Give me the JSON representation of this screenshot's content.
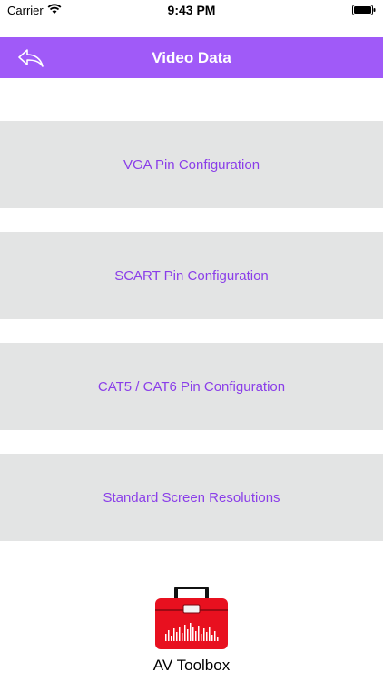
{
  "status_bar": {
    "carrier": "Carrier",
    "time": "9:43 PM",
    "wifi_icon": "wifi-icon",
    "battery_icon": "battery-icon"
  },
  "navbar": {
    "title": "Video Data",
    "back_icon": "back-arrow-icon",
    "background": "#a05af8"
  },
  "menu": {
    "items": [
      {
        "label": "VGA Pin Configuration"
      },
      {
        "label": "SCART Pin Configuration"
      },
      {
        "label": "CAT5 / CAT6 Pin Configuration"
      },
      {
        "label": "Standard Screen Resolutions"
      }
    ],
    "background": "#e3e4e4",
    "text_color": "#8a3ee9"
  },
  "footer": {
    "app_name": "AV Toolbox",
    "logo_icon": "toolbox-icon"
  }
}
